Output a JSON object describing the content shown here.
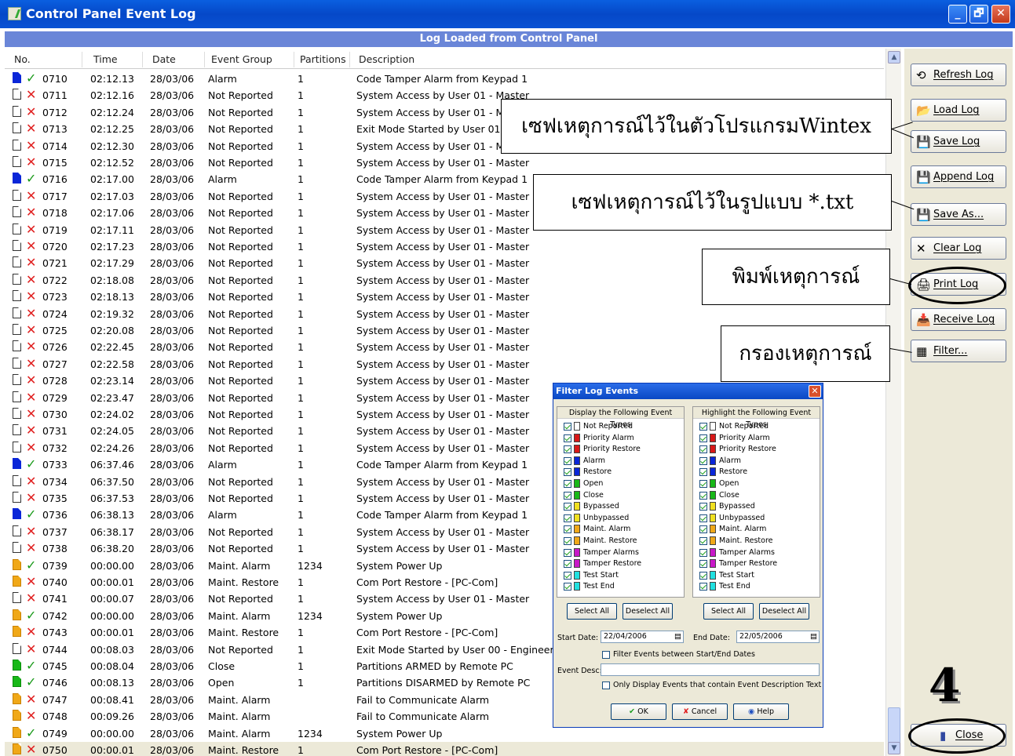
{
  "window": {
    "title": "Control Panel Event Log",
    "subtitle": "Log Loaded from Control Panel",
    "controls": {
      "minimize": "_",
      "maximize": "🗗",
      "close": "✕"
    }
  },
  "table": {
    "columns": [
      "No.",
      "Time",
      "Date",
      "Event Group",
      "Partitions",
      "Description"
    ],
    "rows": [
      {
        "icon": "blue",
        "mark": "ok",
        "no": "0710",
        "time": "02:12.13",
        "date": "28/03/06",
        "group": "Alarm",
        "part": "1",
        "desc": "Code Tamper Alarm from Keypad 1"
      },
      {
        "icon": "white",
        "mark": "x",
        "no": "0711",
        "time": "02:12.16",
        "date": "28/03/06",
        "group": "Not Reported",
        "part": "1",
        "desc": "System Access by User 01 - Master"
      },
      {
        "icon": "white",
        "mark": "x",
        "no": "0712",
        "time": "02:12.24",
        "date": "28/03/06",
        "group": "Not Reported",
        "part": "1",
        "desc": "System Access by User 01 - M"
      },
      {
        "icon": "white",
        "mark": "x",
        "no": "0713",
        "time": "02:12.25",
        "date": "28/03/06",
        "group": "Not Reported",
        "part": "1",
        "desc": "Exit Mode Started by User 01"
      },
      {
        "icon": "white",
        "mark": "x",
        "no": "0714",
        "time": "02:12.30",
        "date": "28/03/06",
        "group": "Not Reported",
        "part": "1",
        "desc": "System Access by User 01 - M"
      },
      {
        "icon": "white",
        "mark": "x",
        "no": "0715",
        "time": "02:12.52",
        "date": "28/03/06",
        "group": "Not Reported",
        "part": "1",
        "desc": "System Access by User 01 - Master"
      },
      {
        "icon": "blue",
        "mark": "ok",
        "no": "0716",
        "time": "02:17.00",
        "date": "28/03/06",
        "group": "Alarm",
        "part": "1",
        "desc": "Code Tamper Alarm from Keypad 1"
      },
      {
        "icon": "white",
        "mark": "x",
        "no": "0717",
        "time": "02:17.03",
        "date": "28/03/06",
        "group": "Not Reported",
        "part": "1",
        "desc": "System Access by User 01 - Master"
      },
      {
        "icon": "white",
        "mark": "x",
        "no": "0718",
        "time": "02:17.06",
        "date": "28/03/06",
        "group": "Not Reported",
        "part": "1",
        "desc": "System Access by User 01 - Master"
      },
      {
        "icon": "white",
        "mark": "x",
        "no": "0719",
        "time": "02:17.11",
        "date": "28/03/06",
        "group": "Not Reported",
        "part": "1",
        "desc": "System Access by User 01 - Master"
      },
      {
        "icon": "white",
        "mark": "x",
        "no": "0720",
        "time": "02:17.23",
        "date": "28/03/06",
        "group": "Not Reported",
        "part": "1",
        "desc": "System Access by User 01 - Master"
      },
      {
        "icon": "white",
        "mark": "x",
        "no": "0721",
        "time": "02:17.29",
        "date": "28/03/06",
        "group": "Not Reported",
        "part": "1",
        "desc": "System Access by User 01 - Master"
      },
      {
        "icon": "white",
        "mark": "x",
        "no": "0722",
        "time": "02:18.08",
        "date": "28/03/06",
        "group": "Not Reported",
        "part": "1",
        "desc": "System Access by User 01 - Master"
      },
      {
        "icon": "white",
        "mark": "x",
        "no": "0723",
        "time": "02:18.13",
        "date": "28/03/06",
        "group": "Not Reported",
        "part": "1",
        "desc": "System Access by User 01 - Master"
      },
      {
        "icon": "white",
        "mark": "x",
        "no": "0724",
        "time": "02:19.32",
        "date": "28/03/06",
        "group": "Not Reported",
        "part": "1",
        "desc": "System Access by User 01 - Master"
      },
      {
        "icon": "white",
        "mark": "x",
        "no": "0725",
        "time": "02:20.08",
        "date": "28/03/06",
        "group": "Not Reported",
        "part": "1",
        "desc": "System Access by User 01 - Master"
      },
      {
        "icon": "white",
        "mark": "x",
        "no": "0726",
        "time": "02:22.45",
        "date": "28/03/06",
        "group": "Not Reported",
        "part": "1",
        "desc": "System Access by User 01 - Master"
      },
      {
        "icon": "white",
        "mark": "x",
        "no": "0727",
        "time": "02:22.58",
        "date": "28/03/06",
        "group": "Not Reported",
        "part": "1",
        "desc": "System Access by User 01 - Master"
      },
      {
        "icon": "white",
        "mark": "x",
        "no": "0728",
        "time": "02:23.14",
        "date": "28/03/06",
        "group": "Not Reported",
        "part": "1",
        "desc": "System Access by User 01 - Master"
      },
      {
        "icon": "white",
        "mark": "x",
        "no": "0729",
        "time": "02:23.47",
        "date": "28/03/06",
        "group": "Not Reported",
        "part": "1",
        "desc": "System Access by User 01 - Master"
      },
      {
        "icon": "white",
        "mark": "x",
        "no": "0730",
        "time": "02:24.02",
        "date": "28/03/06",
        "group": "Not Reported",
        "part": "1",
        "desc": "System Access by User 01 - Master"
      },
      {
        "icon": "white",
        "mark": "x",
        "no": "0731",
        "time": "02:24.05",
        "date": "28/03/06",
        "group": "Not Reported",
        "part": "1",
        "desc": "System Access by User 01 - Master"
      },
      {
        "icon": "white",
        "mark": "x",
        "no": "0732",
        "time": "02:24.26",
        "date": "28/03/06",
        "group": "Not Reported",
        "part": "1",
        "desc": "System Access by User 01 - Master"
      },
      {
        "icon": "blue",
        "mark": "ok",
        "no": "0733",
        "time": "06:37.46",
        "date": "28/03/06",
        "group": "Alarm",
        "part": "1",
        "desc": "Code Tamper Alarm from Keypad 1"
      },
      {
        "icon": "white",
        "mark": "x",
        "no": "0734",
        "time": "06:37.50",
        "date": "28/03/06",
        "group": "Not Reported",
        "part": "1",
        "desc": "System Access by User 01 - Master"
      },
      {
        "icon": "white",
        "mark": "x",
        "no": "0735",
        "time": "06:37.53",
        "date": "28/03/06",
        "group": "Not Reported",
        "part": "1",
        "desc": "System Access by User 01 - Master"
      },
      {
        "icon": "blue",
        "mark": "ok",
        "no": "0736",
        "time": "06:38.13",
        "date": "28/03/06",
        "group": "Alarm",
        "part": "1",
        "desc": "Code Tamper Alarm from Keypad 1"
      },
      {
        "icon": "white",
        "mark": "x",
        "no": "0737",
        "time": "06:38.17",
        "date": "28/03/06",
        "group": "Not Reported",
        "part": "1",
        "desc": "System Access by User 01 - Master"
      },
      {
        "icon": "white",
        "mark": "x",
        "no": "0738",
        "time": "06:38.20",
        "date": "28/03/06",
        "group": "Not Reported",
        "part": "1",
        "desc": "System Access by User 01 - Master"
      },
      {
        "icon": "orange",
        "mark": "ok",
        "no": "0739",
        "time": "00:00.00",
        "date": "28/03/06",
        "group": "Maint. Alarm",
        "part": "1234",
        "desc": "System Power Up"
      },
      {
        "icon": "orange",
        "mark": "x",
        "no": "0740",
        "time": "00:00.01",
        "date": "28/03/06",
        "group": "Maint. Restore",
        "part": "1",
        "desc": "Com Port Restore  - [PC-Com]"
      },
      {
        "icon": "white",
        "mark": "x",
        "no": "0741",
        "time": "00:00.07",
        "date": "28/03/06",
        "group": "Not Reported",
        "part": "1",
        "desc": "System Access by User 01 - Master"
      },
      {
        "icon": "orange",
        "mark": "ok",
        "no": "0742",
        "time": "00:00.00",
        "date": "28/03/06",
        "group": "Maint. Alarm",
        "part": "1234",
        "desc": "System Power Up"
      },
      {
        "icon": "orange",
        "mark": "x",
        "no": "0743",
        "time": "00:00.01",
        "date": "28/03/06",
        "group": "Maint. Restore",
        "part": "1",
        "desc": "Com Port Restore  - [PC-Com]"
      },
      {
        "icon": "white",
        "mark": "x",
        "no": "0744",
        "time": "00:08.03",
        "date": "28/03/06",
        "group": "Not Reported",
        "part": "1",
        "desc": "Exit Mode Started by User 00 - Engineer"
      },
      {
        "icon": "green",
        "mark": "ok",
        "no": "0745",
        "time": "00:08.04",
        "date": "28/03/06",
        "group": "Close",
        "part": "1",
        "desc": "Partitions ARMED by Remote PC"
      },
      {
        "icon": "green",
        "mark": "ok",
        "no": "0746",
        "time": "00:08.13",
        "date": "28/03/06",
        "group": "Open",
        "part": "1",
        "desc": "Partitions DISARMED by Remote PC"
      },
      {
        "icon": "orange",
        "mark": "x",
        "no": "0747",
        "time": "00:08.41",
        "date": "28/03/06",
        "group": "Maint. Alarm",
        "part": "",
        "desc": "Fail to Communicate Alarm"
      },
      {
        "icon": "orange",
        "mark": "x",
        "no": "0748",
        "time": "00:09.26",
        "date": "28/03/06",
        "group": "Maint. Alarm",
        "part": "",
        "desc": "Fail to Communicate Alarm"
      },
      {
        "icon": "orange",
        "mark": "ok",
        "no": "0749",
        "time": "00:00.00",
        "date": "28/03/06",
        "group": "Maint. Alarm",
        "part": "1234",
        "desc": "System Power Up"
      },
      {
        "icon": "orange",
        "mark": "x",
        "no": "0750",
        "time": "00:00.01",
        "date": "28/03/06",
        "group": "Maint. Restore",
        "part": "1",
        "desc": "Com Port Restore  - [PC-Com]",
        "selected": true
      }
    ]
  },
  "sidebar": {
    "buttons": [
      {
        "label": "Refresh Log",
        "icon": "⟲",
        "icon_name": "refresh-icon"
      },
      {
        "label": "Load Log",
        "icon": "📂",
        "icon_name": "folder-icon"
      },
      {
        "label": "Save Log",
        "icon": "💾",
        "icon_name": "disk-icon"
      },
      {
        "label": "Append Log",
        "icon": "💾",
        "icon_name": "disk-icon"
      },
      {
        "label": "Save As...",
        "icon": "💾",
        "icon_name": "disk-icon"
      },
      {
        "label": "Clear Log",
        "icon": "✕",
        "icon_name": "x-icon"
      },
      {
        "label": "Print Log",
        "icon": "🖨",
        "icon_name": "printer-icon"
      },
      {
        "label": "Receive Log",
        "icon": "📥",
        "icon_name": "receive-icon"
      },
      {
        "label": "Filter...",
        "icon": "▦",
        "icon_name": "grid-icon"
      }
    ],
    "close_label": "Close",
    "close_icon": "▮"
  },
  "annotations": {
    "callout_save": "เซฟเหตุการณ์ไว้ในตัวโปรแกรมWintex",
    "callout_saveas": "เซฟเหตุการณ์ไว้ในรูปแบบ *.txt",
    "callout_print": "พิมพ์เหตุการณ์",
    "callout_filter": "กรองเหตุการณ์",
    "step_number": "4"
  },
  "dialog": {
    "title": "Filter Log Events",
    "display_header": "Display the Following Event Types",
    "highlight_header": "Highlight the Following Event Types",
    "event_types": [
      {
        "label": "Not Reported",
        "color": "#ffffff"
      },
      {
        "label": "Priority Alarm",
        "color": "#d81818"
      },
      {
        "label": "Priority Restore",
        "color": "#d81818"
      },
      {
        "label": "Alarm",
        "color": "#0a26d8"
      },
      {
        "label": "Restore",
        "color": "#0a26d8"
      },
      {
        "label": "Open",
        "color": "#18b818"
      },
      {
        "label": "Close",
        "color": "#18b818"
      },
      {
        "label": "Bypassed",
        "color": "#f0e020"
      },
      {
        "label": "Unbypassed",
        "color": "#f0e020"
      },
      {
        "label": "Maint. Alarm",
        "color": "#f0a818"
      },
      {
        "label": "Maint. Restore",
        "color": "#f0a818"
      },
      {
        "label": "Tamper Alarms",
        "color": "#c818c8"
      },
      {
        "label": "Tamper Restore",
        "color": "#c818c8"
      },
      {
        "label": "Test Start",
        "color": "#20e0e0"
      },
      {
        "label": "Test End",
        "color": "#20e0e0"
      }
    ],
    "select_all": "Select All",
    "deselect_all": "Deselect All",
    "start_date_label": "Start Date:",
    "start_date": "22/04/2006",
    "end_date_label": "End Date:",
    "end_date": "22/05/2006",
    "filter_dates_label": "Filter Events between Start/End Dates",
    "event_desc_label": "Event Desc:",
    "event_desc_value": "",
    "only_display_label": "Only Display Events that contain Event Description Text",
    "ok": "OK",
    "cancel": "Cancel",
    "help": "Help"
  }
}
